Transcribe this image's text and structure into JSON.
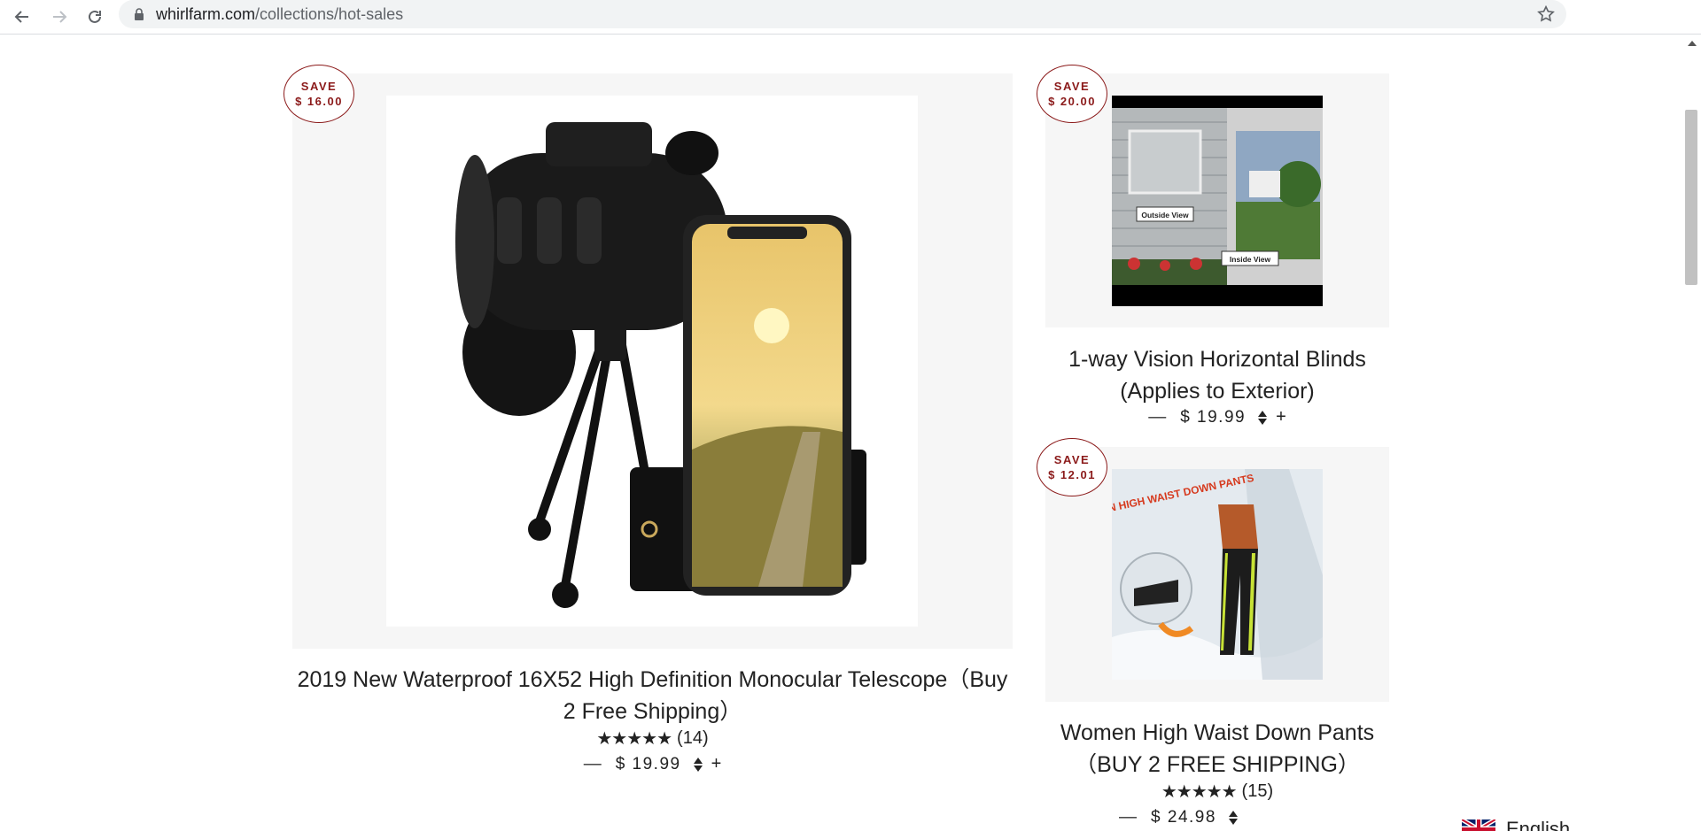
{
  "browser": {
    "url_host": "whirlfarm.com",
    "url_path": "/collections/hot-sales"
  },
  "products": [
    {
      "save_label": "SAVE",
      "save_amount": "$ 16.00",
      "title": "2019 New Waterproof 16X52 High Definition Monocular Telescope（Buy 2 Free Shipping）",
      "stars": "★★★★★",
      "review_count": "(14)",
      "rating": 5,
      "dash": "—",
      "price": "$ 19.99",
      "plus": "+"
    },
    {
      "save_label": "SAVE",
      "save_amount": "$ 20.00",
      "title": "1-way Vision Horizontal Blinds (Applies to Exterior)",
      "dash": "—",
      "price": "$ 19.99",
      "plus": "+",
      "image_labels": [
        "Outside View",
        "Inside View"
      ]
    },
    {
      "save_label": "SAVE",
      "save_amount": "$ 12.01",
      "title": "Women High Waist Down Pants（BUY 2 FREE SHIPPING）",
      "stars": "★★★★★",
      "review_count": "(15)",
      "rating": 5,
      "dash": "—",
      "price": "$ 24.98",
      "image_text": "WOMEN HIGH WAIST DOWN PANTS"
    }
  ],
  "language": {
    "label": "English",
    "flag_icon": "uk-flag-icon"
  },
  "colors": {
    "badge": "#8b1a1a",
    "panel_bg": "#f6f6f6"
  }
}
